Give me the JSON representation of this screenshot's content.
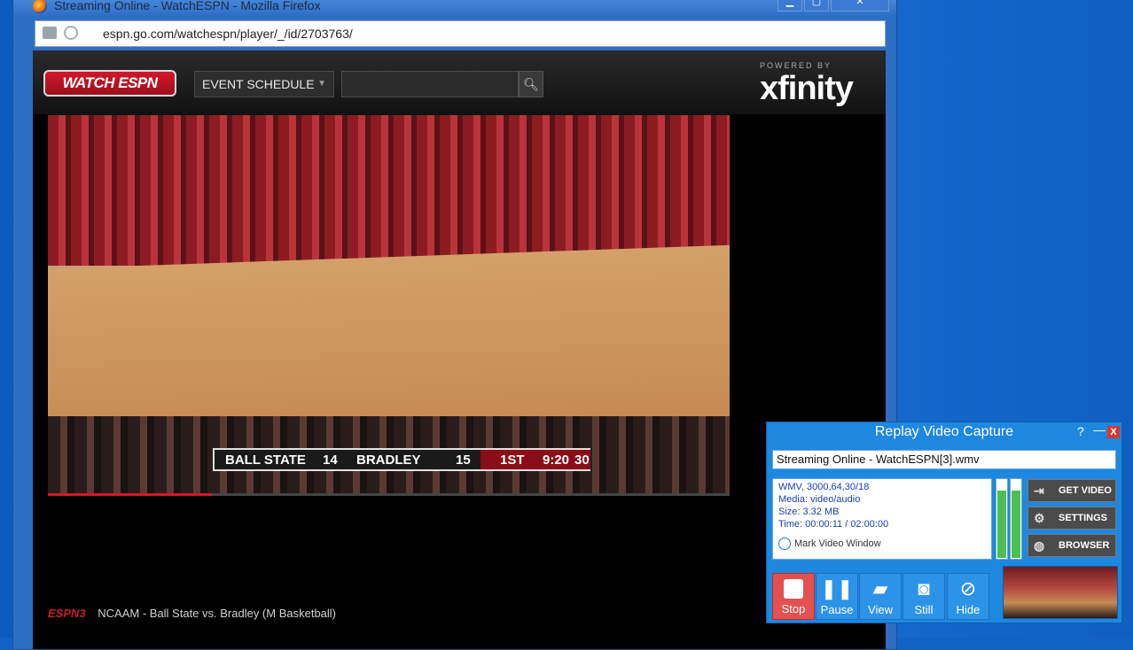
{
  "window": {
    "title": "Streaming Online - WatchESPN - Mozilla Firefox",
    "url": "espn.go.com/watchespn/player/_/id/2703763/",
    "buttons": {
      "minimize": "▁",
      "maximize": "▢",
      "close": "✕"
    }
  },
  "espn": {
    "logo_text": "WATCH ESPN",
    "event_schedule_label": "EVENT SCHEDULE",
    "search_placeholder": "",
    "powered_by": "POWERED BY",
    "sponsor": "xfinity"
  },
  "scorebug": {
    "team1": "BALL STATE",
    "score1": "14",
    "team2": "BRADLEY",
    "score2": "15",
    "period": "1ST",
    "clock": "9:20",
    "shot_clock": "30",
    "progress": 0.24
  },
  "caption": {
    "network": "ESPN3",
    "text": "NCAAM - Ball State vs. Bradley (M Basketball)"
  },
  "rvc": {
    "title": "Replay Video Capture",
    "help": "?",
    "minimize": "—",
    "close": "X",
    "filename": "Streaming Online - WatchESPN[3].wmv",
    "info": {
      "format": "WMV, 3000,64,30/18",
      "media": "Media: video/audio",
      "size": "Size: 3.32  MB",
      "time": "Time: 00:00:11  / 02:00:00"
    },
    "mark_window": "Mark Video Window",
    "meter_levels": [
      0.85,
      0.85
    ],
    "side_buttons": {
      "get_video": "GET VIDEO",
      "settings": "SETTINGS",
      "browser": "BROWSER"
    },
    "toolbar": {
      "stop": "Stop",
      "pause": "Pause",
      "view": "View",
      "still": "Still",
      "hide": "Hide"
    }
  }
}
